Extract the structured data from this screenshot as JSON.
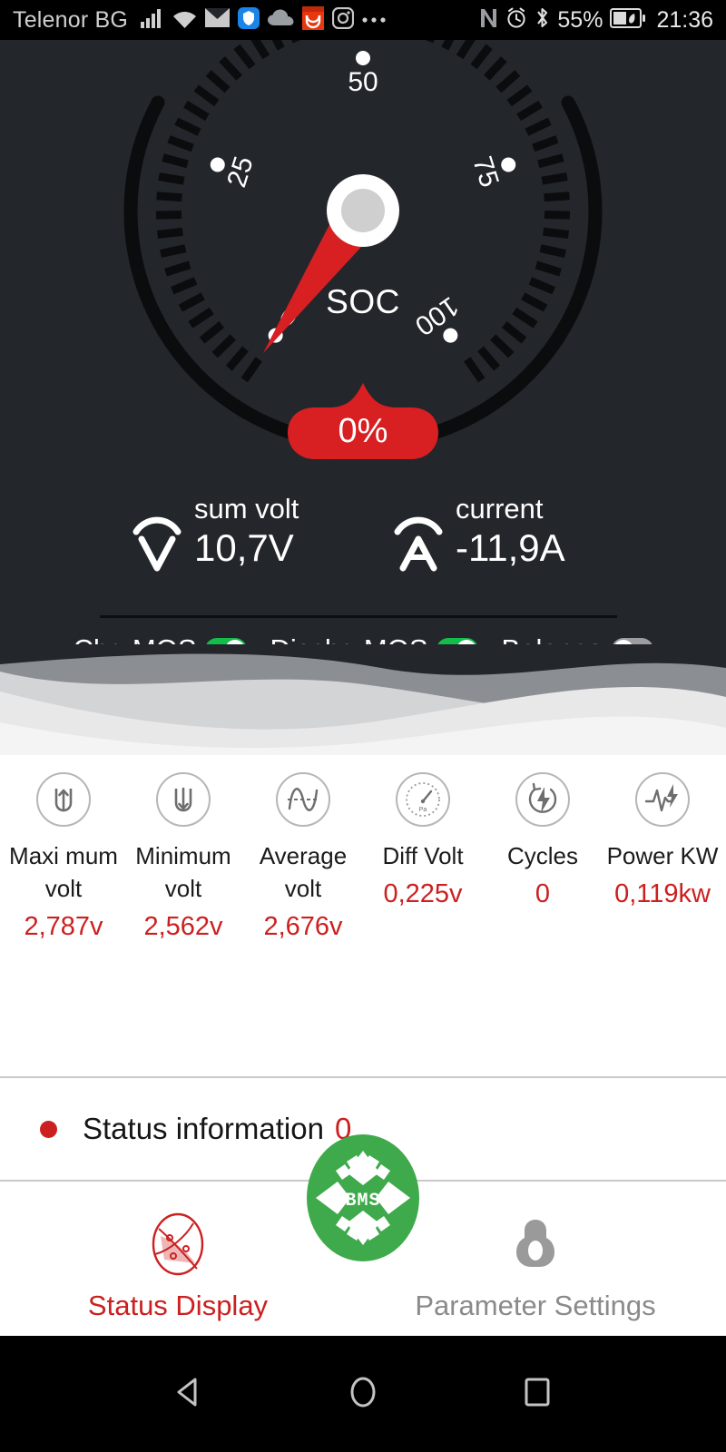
{
  "statusbar": {
    "carrier": "Telenor BG",
    "battery_percent": "55%",
    "time": "21:36",
    "icons": [
      "signal-bars-icon",
      "wifi-icon",
      "envelope-icon",
      "shield-icon",
      "cloud-icon",
      "aliexpress-icon",
      "instagram-icon",
      "overflow-dots-icon"
    ],
    "right_icons": [
      "nfc-icon",
      "alarm-clock-icon",
      "bluetooth-icon",
      "battery-saver-icon"
    ]
  },
  "gauge": {
    "label": "SOC",
    "value_text": "0%",
    "value": 0,
    "min": 0,
    "max": 100,
    "ticks": [
      "0",
      "25",
      "50",
      "75",
      "100"
    ],
    "needle_color": "#d81f21",
    "badge_color": "#d81f21",
    "dial_color": "#23262b"
  },
  "meters": [
    {
      "name": "sum volt",
      "value": "10,7V",
      "icon": "voltmeter-icon"
    },
    {
      "name": "current",
      "value": "-11,9A",
      "icon": "ammeter-icon"
    }
  ],
  "toggles": [
    {
      "label": "Chg MOS",
      "state": "on",
      "icon": "toggle-switch"
    },
    {
      "label": "Dischg MOS",
      "state": "on",
      "icon": "toggle-switch"
    },
    {
      "label": "Balance",
      "state": "off",
      "icon": "toggle-switch"
    }
  ],
  "stats": [
    {
      "label": "Maxi mum volt",
      "value": "2,787v",
      "icon": "voltage-up-icon"
    },
    {
      "label": "Minimum volt",
      "value": "2,562v",
      "icon": "voltage-down-icon"
    },
    {
      "label": "Average volt",
      "value": "2,676v",
      "icon": "sine-wave-icon"
    },
    {
      "label": "Diff Volt",
      "value": "0,225v",
      "icon": "pressure-gauge-icon"
    },
    {
      "label": "Cycles",
      "value": "0",
      "icon": "bolt-circle-icon"
    },
    {
      "label": "Power KW",
      "value": "0,119kw",
      "icon": "waveform-bolt-icon"
    }
  ],
  "status_information": {
    "label": "Status information",
    "count": "0",
    "dot_color": "#cc2020"
  },
  "bottom_nav": {
    "fab_label": "BMS",
    "fab_color": "#3faa4b",
    "items": [
      {
        "label": "Status Display",
        "state": "active",
        "icon": "status-display-icon"
      },
      {
        "label": "Parameter Settings",
        "state": "inactive",
        "icon": "settings-gear-icon"
      }
    ]
  },
  "android_nav": {
    "buttons": [
      "back-icon",
      "home-icon",
      "recents-icon"
    ]
  },
  "colors": {
    "accent_red": "#cc2020",
    "green": "#13bf4a",
    "dark_panel": "#23262b"
  }
}
